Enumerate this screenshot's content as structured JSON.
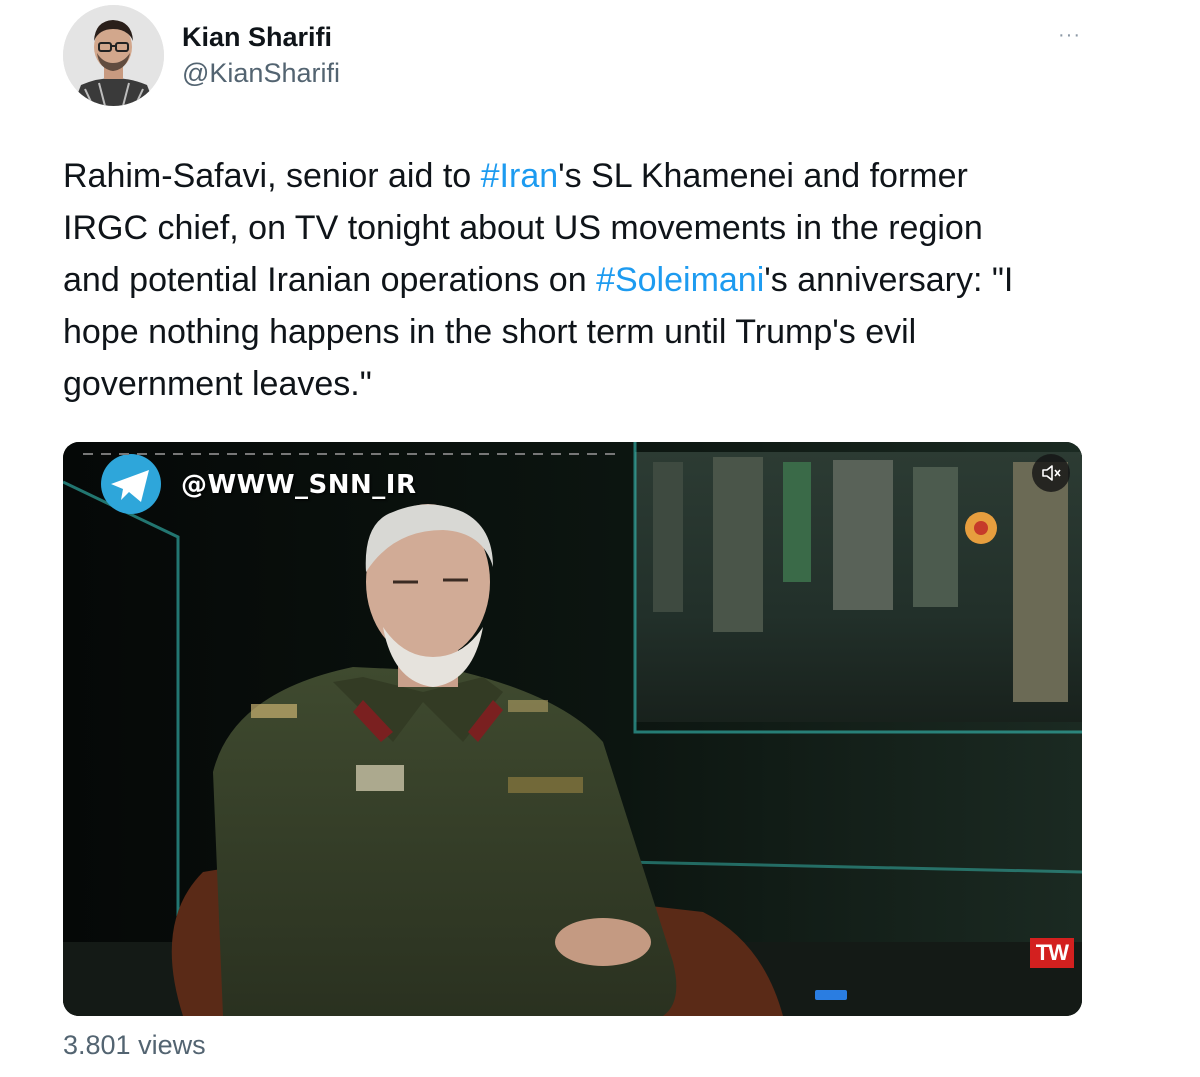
{
  "author": {
    "name": "Kian Sharifi",
    "handle": "@KianSharifi"
  },
  "menu_label": "···",
  "tweet": {
    "lines": [
      [
        {
          "text": "Rahim-Safavi, senior aid to ",
          "type": "text"
        },
        {
          "text": "#Iran",
          "type": "hashtag"
        },
        {
          "text": "'s SL Khamenei and former",
          "type": "text"
        }
      ],
      [
        {
          "text": "IRGC chief, on TV tonight about US movements in the region",
          "type": "text"
        }
      ],
      [
        {
          "text": "and potential Iranian operations on ",
          "type": "text"
        },
        {
          "text": "#Soleimani",
          "type": "hashtag"
        },
        {
          "text": "'s anniversary: \"I",
          "type": "text"
        }
      ],
      [
        {
          "text": "hope nothing happens in the short term until Trump's evil",
          "type": "text"
        }
      ],
      [
        {
          "text": "government leaves.\"",
          "type": "text"
        }
      ]
    ]
  },
  "video": {
    "watermark": "@WWW_SNN_IR",
    "channel_logo": "TW",
    "mute_icon": "speaker-muted-icon",
    "colors": {
      "accent": "#1d9bf0",
      "logo_red": "#d3201f"
    }
  },
  "stats": {
    "views": "3.801 views"
  }
}
